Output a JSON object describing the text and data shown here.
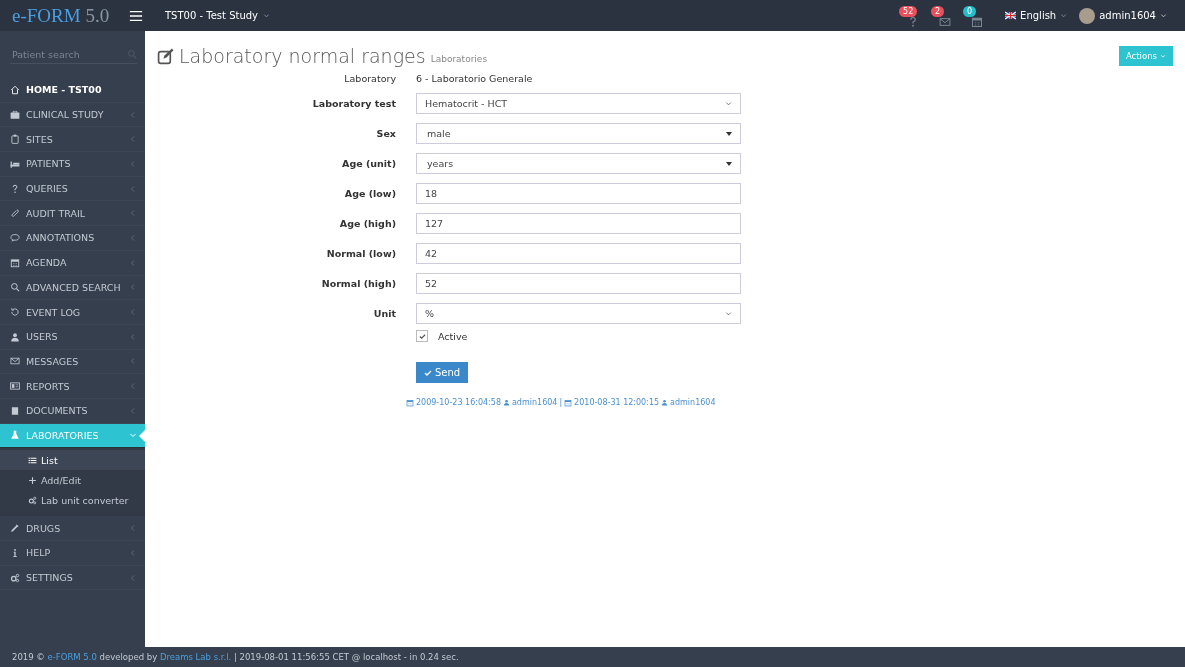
{
  "header": {
    "logo": "e-FORM",
    "version": "5.0",
    "study": "TST00 - Test Study",
    "notifications": [
      {
        "count": "52",
        "color": "#e8505b"
      },
      {
        "count": "2",
        "color": "#e8505b"
      },
      {
        "count": "0",
        "color": "#26bcc9"
      }
    ],
    "language": "English",
    "user": "admin1604"
  },
  "sidebar": {
    "search": {
      "placeholder": "Patient search"
    },
    "items": [
      {
        "label": "HOME - TST00",
        "kind": "link",
        "selected": false
      },
      {
        "label": "CLINICAL STUDY",
        "kind": "group",
        "selected": false,
        "expanded": false
      },
      {
        "label": "SITES",
        "kind": "group",
        "selected": false,
        "expanded": false
      },
      {
        "label": "PATIENTS",
        "kind": "group",
        "selected": false,
        "expanded": false
      },
      {
        "label": "QUERIES",
        "kind": "group",
        "selected": false,
        "expanded": false
      },
      {
        "label": "AUDIT TRAIL",
        "kind": "group",
        "selected": false,
        "expanded": false
      },
      {
        "label": "ANNOTATIONS",
        "kind": "group",
        "selected": false,
        "expanded": false
      },
      {
        "label": "AGENDA",
        "kind": "group",
        "selected": false,
        "expanded": false
      },
      {
        "label": "ADVANCED SEARCH",
        "kind": "group",
        "selected": false,
        "expanded": false
      },
      {
        "label": "EVENT LOG",
        "kind": "group",
        "selected": false,
        "expanded": false
      },
      {
        "label": "USERS",
        "kind": "group",
        "selected": false,
        "expanded": false
      },
      {
        "label": "MESSAGES",
        "kind": "group",
        "selected": false,
        "expanded": false
      },
      {
        "label": "REPORTS",
        "kind": "group",
        "selected": false,
        "expanded": false
      },
      {
        "label": "DOCUMENTS",
        "kind": "group",
        "selected": false,
        "expanded": false
      },
      {
        "label": "LABORATORIES",
        "kind": "group",
        "selected": true,
        "expanded": true,
        "children": [
          {
            "label": "List",
            "selected": true
          },
          {
            "label": "Add/Edit",
            "selected": false
          },
          {
            "label": "Lab unit converter",
            "selected": false
          }
        ]
      },
      {
        "label": "DRUGS",
        "kind": "group",
        "selected": false,
        "expanded": false
      },
      {
        "label": "HELP",
        "kind": "group",
        "selected": false,
        "expanded": false
      },
      {
        "label": "SETTINGS",
        "kind": "group",
        "selected": false,
        "expanded": false
      }
    ]
  },
  "page": {
    "title": "Laboratory normal ranges",
    "subtitle": "Laboratories",
    "actions": "Actions",
    "fields": [
      {
        "label": "Laboratory",
        "kind": "static",
        "value": "6 - Laboratorio Generale"
      },
      {
        "label": "Laboratory test",
        "kind": "select",
        "value": "Hematocrit - HCT"
      },
      {
        "label": "Sex",
        "kind": "dropdown",
        "value": "male"
      },
      {
        "label": "Age (unit)",
        "kind": "dropdown",
        "value": "years"
      },
      {
        "label": "Age (low)",
        "kind": "text",
        "value": "18"
      },
      {
        "label": "Age (high)",
        "kind": "text",
        "value": "127"
      },
      {
        "label": "Normal (low)",
        "kind": "text",
        "value": "42"
      },
      {
        "label": "Normal (high)",
        "kind": "text",
        "value": "52"
      },
      {
        "label": "Unit",
        "kind": "select",
        "value": "%"
      },
      {
        "label": "Active",
        "kind": "checkbox",
        "checked": true
      }
    ],
    "send": "Send",
    "separator": "|",
    "meta": [
      {
        "date": "2009-10-23 16:04:58",
        "user": "admin1604"
      },
      {
        "date": "2010-08-31 12:00:15",
        "user": "admin1604"
      }
    ]
  },
  "footer": {
    "year": "2019 ©",
    "product": "e-FORM 5.0",
    "developed_by": "developed by",
    "company": "Dreams Lab s.r.l.",
    "info": "| 2019-08-01 11:56:55 CET @ localhost - in 0.24 sec."
  }
}
